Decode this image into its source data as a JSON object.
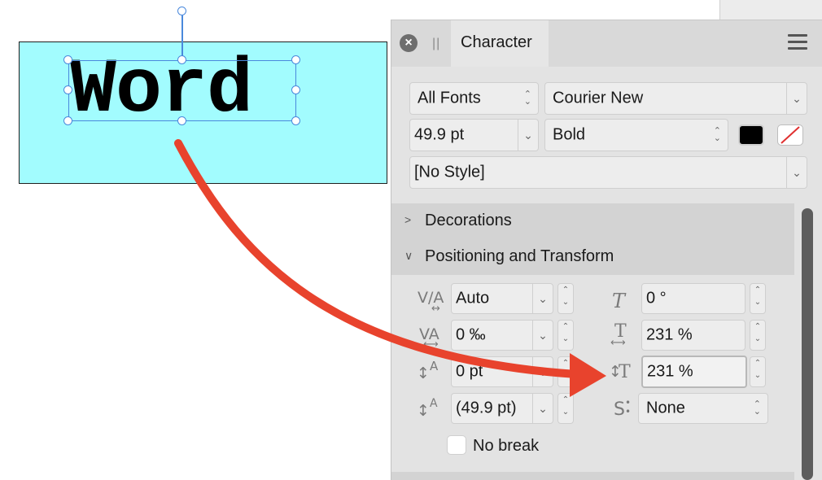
{
  "canvas": {
    "word": "Word"
  },
  "panel": {
    "tab_title": "Character",
    "font_collection": "All Fonts",
    "font_family": "Courier New",
    "font_size": "49.9 pt",
    "font_style": "Bold",
    "paragraph_style": "[No Style]",
    "fill_color": "#000000",
    "stroke_color": "none",
    "sections": {
      "decorations": "Decorations",
      "positioning": "Positioning and Transform"
    },
    "fields": {
      "kerning": "Auto",
      "tracking": "0 ‰",
      "baseline": "0 pt",
      "leading": "(49.9 pt)",
      "skew": "0 °",
      "scale_horizontal": "231 %",
      "scale_vertical": "231 %",
      "typographic_case": "None"
    },
    "no_break_label": "No break"
  },
  "icons": {
    "kerning_label": "V/A",
    "tracking_label": "VA",
    "baseline_label": "A",
    "leading_label": "A",
    "skew_label": "T",
    "scale_h_label": "T",
    "scale_v_label": "T",
    "case_label": "S"
  },
  "colors": {
    "arrow": "#e8432d",
    "frame_fill": "#a2fcfe",
    "selection": "#4a89dc"
  }
}
